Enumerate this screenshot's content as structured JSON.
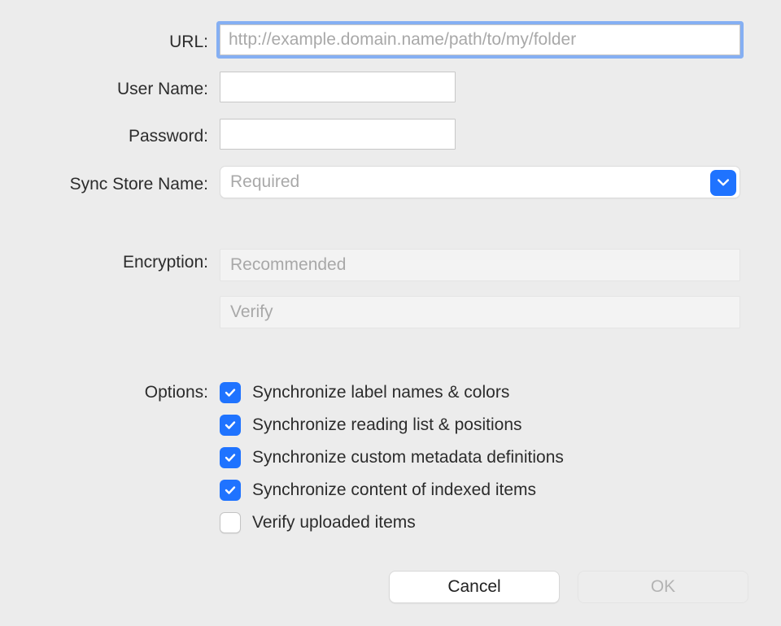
{
  "labels": {
    "url": "URL:",
    "username": "User Name:",
    "password": "Password:",
    "syncstore": "Sync Store Name:",
    "encryption": "Encryption:",
    "options": "Options:"
  },
  "placeholders": {
    "url": "http://example.domain.name/path/to/my/folder",
    "syncstore": "Required",
    "encryption": "Recommended",
    "verify": "Verify"
  },
  "values": {
    "url": "",
    "username": "",
    "password": ""
  },
  "options": {
    "labels": "Synchronize label names & colors",
    "reading": "Synchronize reading list & positions",
    "metadata": "Synchronize custom metadata definitions",
    "indexed": "Synchronize content of indexed items",
    "verifyup": "Verify uploaded items"
  },
  "buttons": {
    "cancel": "Cancel",
    "ok": "OK"
  }
}
